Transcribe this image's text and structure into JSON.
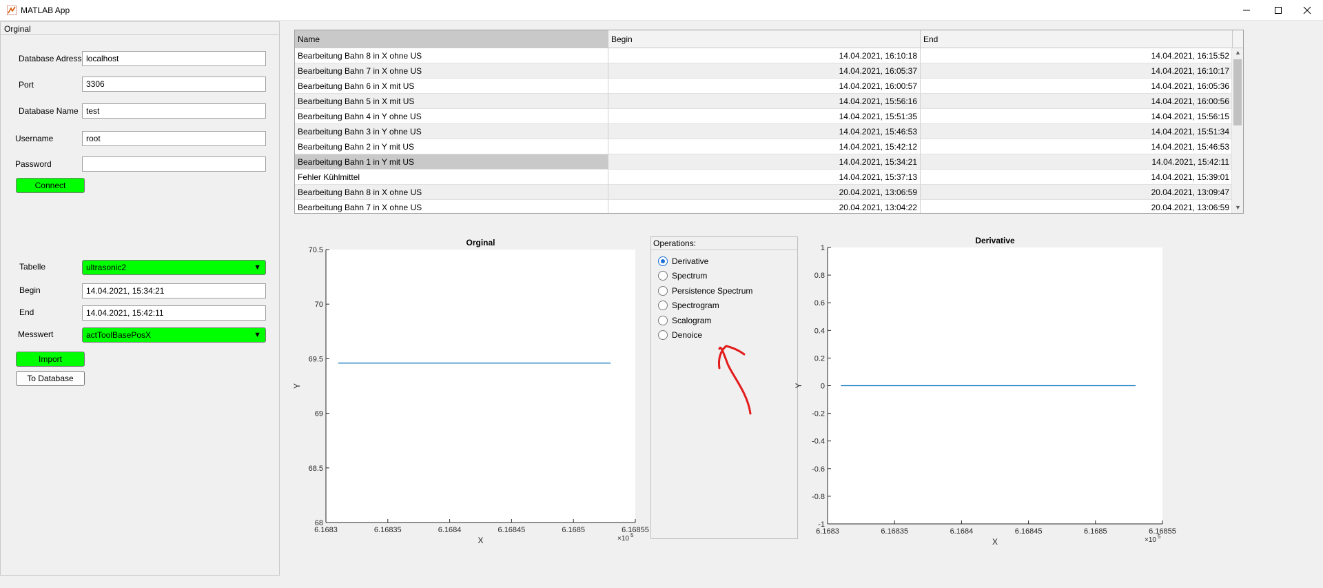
{
  "window": {
    "title": "MATLAB App"
  },
  "left_panel": {
    "title": "Orginal",
    "db_address_label": "Database Adress",
    "db_address_value": "localhost",
    "port_label": "Port",
    "port_value": "3306",
    "db_name_label": "Database Name",
    "db_name_value": "test",
    "username_label": "Username",
    "username_value": "root",
    "password_label": "Password",
    "password_value": "",
    "connect_label": "Connect",
    "tabelle_label": "Tabelle",
    "tabelle_value": "ultrasonic2",
    "begin_label": "Begin",
    "begin_value": "14.04.2021, 15:34:21",
    "end_label": "End",
    "end_value": "14.04.2021, 15:42:11",
    "messwert_label": "Messwert",
    "messwert_value": "actToolBasePosX",
    "import_label": "Import",
    "to_database_label": "To Database"
  },
  "table": {
    "columns": [
      "Name",
      "Begin",
      "End"
    ],
    "rows": [
      [
        "Bearbeitung Bahn 8 in X ohne US",
        "14.04.2021, 16:10:18",
        "14.04.2021, 16:15:52"
      ],
      [
        "Bearbeitung Bahn 7 in X ohne US",
        "14.04.2021, 16:05:37",
        "14.04.2021, 16:10:17"
      ],
      [
        "Bearbeitung Bahn 6 in X mit US",
        "14.04.2021, 16:00:57",
        "14.04.2021, 16:05:36"
      ],
      [
        "Bearbeitung Bahn 5 in X mit US",
        "14.04.2021, 15:56:16",
        "14.04.2021, 16:00:56"
      ],
      [
        "Bearbeitung Bahn 4 in Y ohne US",
        "14.04.2021, 15:51:35",
        "14.04.2021, 15:56:15"
      ],
      [
        "Bearbeitung Bahn 3 in Y ohne US",
        "14.04.2021, 15:46:53",
        "14.04.2021, 15:51:34"
      ],
      [
        "Bearbeitung Bahn 2 in Y mit US",
        "14.04.2021, 15:42:12",
        "14.04.2021, 15:46:53"
      ],
      [
        "Bearbeitung Bahn 1 in Y mit US",
        "14.04.2021, 15:34:21",
        "14.04.2021, 15:42:11"
      ],
      [
        "Fehler Kühlmittel",
        "14.04.2021, 15:37:13",
        "14.04.2021, 15:39:01"
      ],
      [
        "Bearbeitung Bahn 8 in X ohne US",
        "20.04.2021, 13:06:59",
        "20.04.2021, 13:09:47"
      ],
      [
        "Bearbeitung Bahn 7 in X ohne US",
        "20.04.2021, 13:04:22",
        "20.04.2021, 13:06:59"
      ]
    ],
    "selected_row": 7
  },
  "operations": {
    "title": "Operations:",
    "options": [
      "Derivative",
      "Spectrum",
      "Persistence Spectrum",
      "Spectrogram",
      "Scalogram",
      "Denoice"
    ],
    "selected": "Derivative"
  },
  "colors": {
    "accent_green": "#00ff00",
    "line_blue": "#0072bd",
    "annotation_red": "#e31b1b"
  },
  "chart_data": [
    {
      "type": "line",
      "title": "Orginal",
      "xlabel": "X",
      "ylabel": "Y",
      "x_exponent": "×10",
      "x_exponent_power": "5",
      "xlim": [
        6.1683,
        6.16855
      ],
      "ylim": [
        68,
        70.5
      ],
      "xticks": [
        6.1683,
        6.16835,
        6.1684,
        6.16845,
        6.1685,
        6.16855
      ],
      "xtick_labels": [
        "6.1683",
        "6.16835",
        "6.1684",
        "6.16845",
        "6.1685",
        "6.16855"
      ],
      "yticks": [
        68,
        68.5,
        69,
        69.5,
        70,
        70.5
      ],
      "ytick_labels": [
        "68",
        "68.5",
        "69",
        "69.5",
        "70",
        "70.5"
      ],
      "series": [
        {
          "x": [
            6.16831,
            6.16853
          ],
          "y": [
            69.46,
            69.46
          ]
        }
      ]
    },
    {
      "type": "line",
      "title": "Derivative",
      "xlabel": "X",
      "ylabel": "Y",
      "x_exponent": "×10",
      "x_exponent_power": "5",
      "xlim": [
        6.1683,
        6.16855
      ],
      "ylim": [
        -1,
        1
      ],
      "xticks": [
        6.1683,
        6.16835,
        6.1684,
        6.16845,
        6.1685,
        6.16855
      ],
      "xtick_labels": [
        "6.1683",
        "6.16835",
        "6.1684",
        "6.16845",
        "6.1685",
        "6.16855"
      ],
      "yticks": [
        -1,
        -0.8,
        -0.6,
        -0.4,
        -0.2,
        0,
        0.2,
        0.4,
        0.6,
        0.8,
        1
      ],
      "ytick_labels": [
        "-1",
        "-0.8",
        "-0.6",
        "-0.4",
        "-0.2",
        "0",
        "0.2",
        "0.4",
        "0.6",
        "0.8",
        "1"
      ],
      "series": [
        {
          "x": [
            6.16831,
            6.16853
          ],
          "y": [
            0,
            0
          ]
        }
      ]
    }
  ]
}
